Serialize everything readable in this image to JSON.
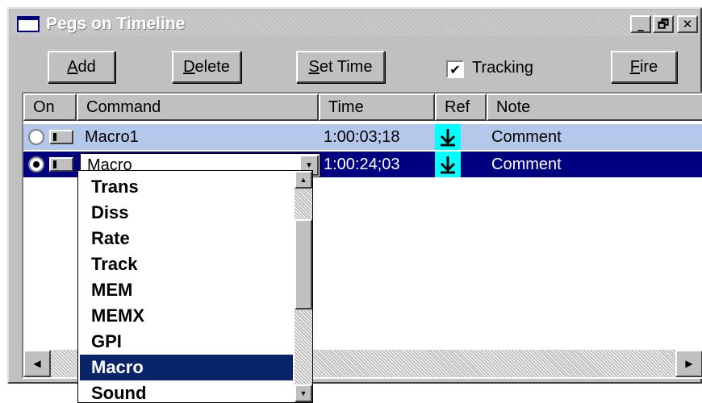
{
  "window": {
    "title": "Pegs on Timeline",
    "minimize_glyph": "_",
    "restore_glyph": "🗗",
    "close_glyph": "✕"
  },
  "toolbar": {
    "add": {
      "mnemonic": "A",
      "rest": "dd"
    },
    "delete": {
      "mnemonic": "D",
      "rest": "elete"
    },
    "set_time": {
      "mnemonic": "S",
      "rest": "et Time"
    },
    "tracking_label": "Tracking",
    "tracking_checked": true,
    "fire": {
      "mnemonic": "F",
      "rest": "ire"
    }
  },
  "columns": {
    "on": "On",
    "command": "Command",
    "time": "Time",
    "ref": "Ref",
    "note": "Note"
  },
  "rows": [
    {
      "on": false,
      "command": "Macro1",
      "time": "1:00:03;18",
      "ref_icon": "down-arrow-ref-icon",
      "note": "Comment"
    },
    {
      "on": true,
      "command": "Macro",
      "time": "1:00:24;03",
      "ref_icon": "down-arrow-ref-icon",
      "note": "Comment"
    }
  ],
  "dropdown": {
    "options": [
      "Trans",
      "Diss",
      "Rate",
      "Track",
      "MEM",
      "MEMX",
      "GPI",
      "Macro",
      "Sound"
    ],
    "selected": "Macro"
  },
  "colors": {
    "row_highlight": "#b4c8ec",
    "row_selected": "#000080",
    "ref_cell": "#00ffff",
    "dropdown_selected": "#0a246a"
  }
}
